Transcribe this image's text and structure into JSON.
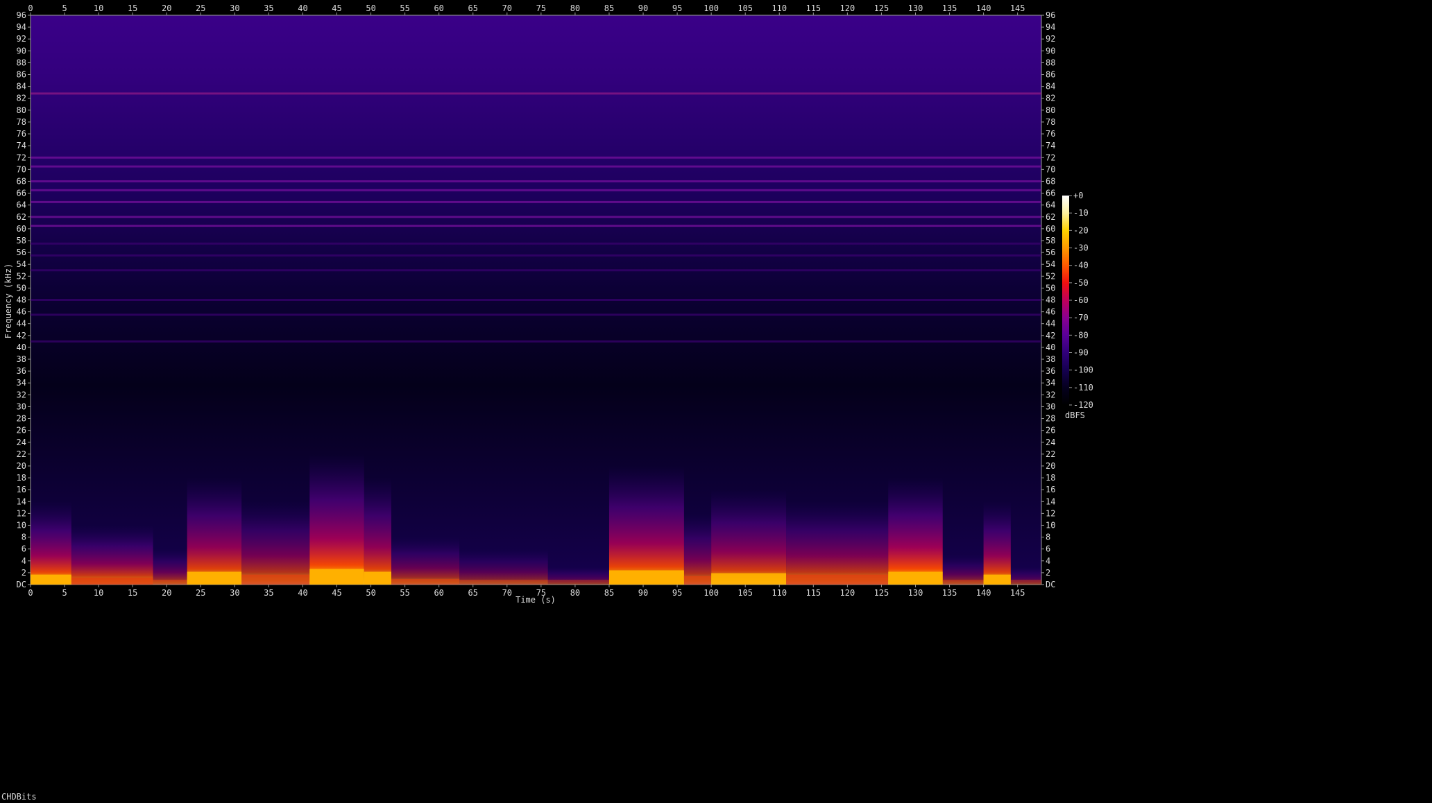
{
  "chart_data": {
    "type": "heatmap",
    "title": "",
    "xlabel": "Time (s)",
    "ylabel": "Frequency (kHz)",
    "xlim": [
      0,
      148.5
    ],
    "ylim": [
      0,
      96
    ],
    "x_ticks": [
      "0",
      "5",
      "10",
      "15",
      "20",
      "25",
      "30",
      "35",
      "40",
      "45",
      "50",
      "55",
      "60",
      "65",
      "70",
      "75",
      "80",
      "85",
      "90",
      "95",
      "100",
      "105",
      "110",
      "115",
      "120",
      "125",
      "130",
      "135",
      "140",
      "145"
    ],
    "y_ticks": [
      "DC",
      "2",
      "4",
      "6",
      "8",
      "10",
      "12",
      "14",
      "16",
      "18",
      "20",
      "22",
      "24",
      "26",
      "28",
      "30",
      "32",
      "34",
      "36",
      "38",
      "40",
      "42",
      "44",
      "46",
      "48",
      "50",
      "52",
      "54",
      "56",
      "58",
      "60",
      "62",
      "64",
      "66",
      "68",
      "70",
      "72",
      "74",
      "76",
      "78",
      "80",
      "82",
      "84",
      "86",
      "88",
      "90",
      "92",
      "94",
      "96"
    ],
    "colorbar": {
      "label": "dBFS",
      "ticks": [
        "+0",
        "-10",
        "-20",
        "-30",
        "-40",
        "-50",
        "-60",
        "-70",
        "-80",
        "-90",
        "-100",
        "-110",
        "-120"
      ],
      "colors": [
        "#ffffff",
        "#fff2a0",
        "#ffd200",
        "#ff9a00",
        "#ff5a00",
        "#f01010",
        "#c0005a",
        "#8a0090",
        "#5a0098",
        "#30007a",
        "#150050",
        "#05001e",
        "#000000"
      ]
    },
    "energy_envelope": {
      "description": "loud low-frequency segments",
      "segments": [
        [
          0,
          6
        ],
        [
          6,
          18
        ],
        [
          18,
          23
        ],
        [
          23,
          31
        ],
        [
          31,
          41
        ],
        [
          41,
          49
        ],
        [
          49,
          53
        ],
        [
          53,
          63
        ],
        [
          63,
          76
        ],
        [
          76,
          85
        ],
        [
          85,
          96
        ],
        [
          96,
          100
        ],
        [
          100,
          111
        ],
        [
          111,
          126
        ],
        [
          126,
          134
        ],
        [
          134,
          140
        ],
        [
          140,
          144
        ],
        [
          144,
          148.5
        ]
      ],
      "levels": [
        0.95,
        0.8,
        0.55,
        0.9,
        0.7,
        1.0,
        0.9,
        0.6,
        0.45,
        0.3,
        0.95,
        0.7,
        0.85,
        0.75,
        1.0,
        0.45,
        0.9,
        0.3
      ],
      "reach_khz": [
        14,
        10,
        6,
        18,
        14,
        22,
        18,
        8,
        6,
        3,
        20,
        12,
        16,
        14,
        18,
        5,
        14,
        3
      ]
    },
    "tone_lines_khz": [
      82.8,
      72,
      70.5,
      68,
      66.5,
      64.5,
      62,
      60.5,
      57.5,
      55.5,
      53,
      48,
      45.5,
      41
    ]
  },
  "footer": {
    "text": "CHDBits"
  }
}
